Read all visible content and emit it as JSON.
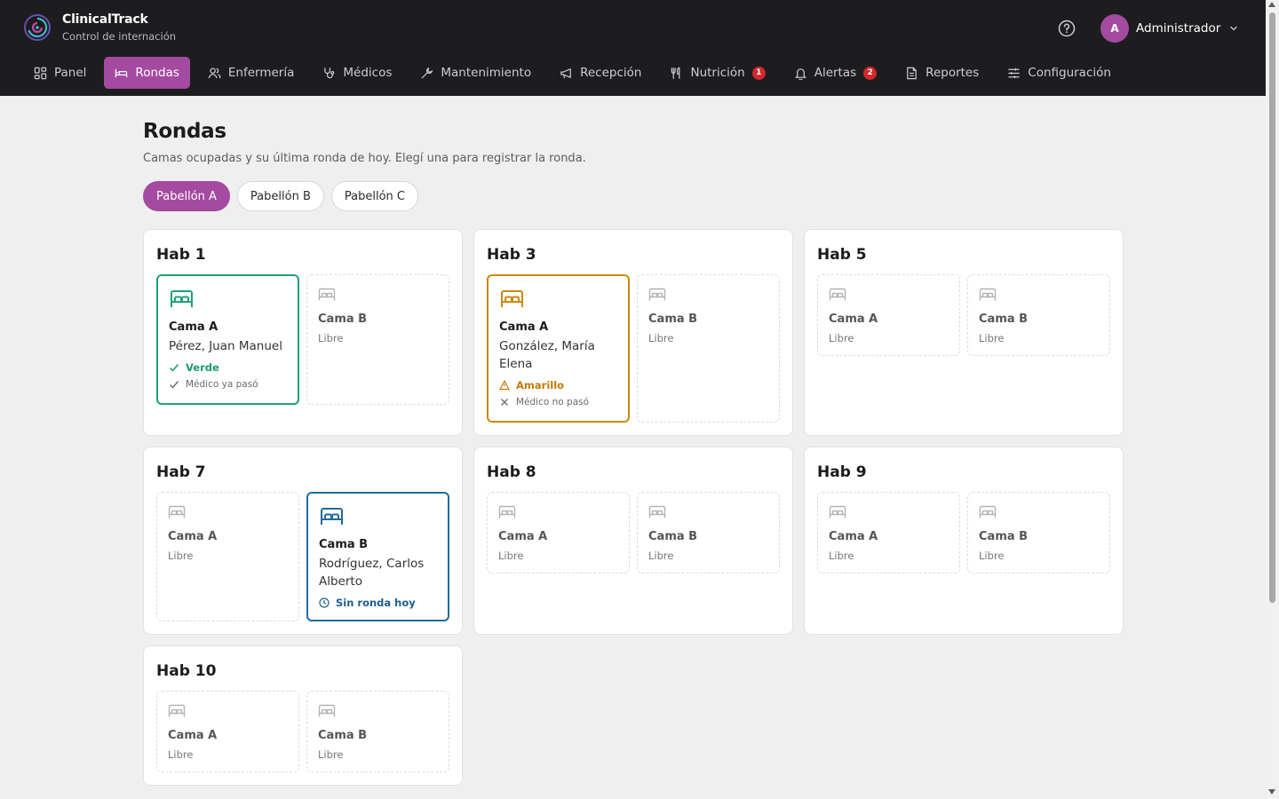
{
  "app": {
    "name": "ClinicalTrack",
    "subtitle": "Control de internación"
  },
  "user": {
    "initial": "A",
    "name": "Administrador"
  },
  "nav": [
    {
      "label": "Panel",
      "icon": "grid-icon"
    },
    {
      "label": "Rondas",
      "icon": "bed-icon",
      "active": true
    },
    {
      "label": "Enfermería",
      "icon": "users-icon"
    },
    {
      "label": "Médicos",
      "icon": "stethoscope-icon"
    },
    {
      "label": "Mantenimiento",
      "icon": "wrench-icon"
    },
    {
      "label": "Recepción",
      "icon": "megaphone-icon"
    },
    {
      "label": "Nutrición",
      "icon": "utensils-icon",
      "badge": "1"
    },
    {
      "label": "Alertas",
      "icon": "bell-icon",
      "badge": "2"
    },
    {
      "label": "Reportes",
      "icon": "file-icon"
    },
    {
      "label": "Configuración",
      "icon": "sliders-icon"
    }
  ],
  "page": {
    "title": "Rondas",
    "subtitle": "Camas ocupadas y su última ronda de hoy. Elegí una para registrar la ronda."
  },
  "pavilions": [
    "Pabellón A",
    "Pabellón B",
    "Pabellón C"
  ],
  "rooms": [
    {
      "title": "Hab 1",
      "beds": [
        {
          "name": "Cama A",
          "patient": "Pérez, Juan Manuel",
          "status": "Verde",
          "doctor": "Médico ya pasó"
        },
        {
          "name": "Cama B",
          "status": "Libre"
        }
      ]
    },
    {
      "title": "Hab 3",
      "beds": [
        {
          "name": "Cama A",
          "patient": "González, María Elena",
          "status": "Amarillo",
          "doctor": "Médico no pasó"
        },
        {
          "name": "Cama B",
          "status": "Libre"
        }
      ]
    },
    {
      "title": "Hab 5",
      "beds": [
        {
          "name": "Cama A",
          "status": "Libre"
        },
        {
          "name": "Cama B",
          "status": "Libre"
        }
      ]
    },
    {
      "title": "Hab 7",
      "beds": [
        {
          "name": "Cama A",
          "status": "Libre"
        },
        {
          "name": "Cama B",
          "patient": "Rodríguez, Carlos Alberto",
          "status": "Sin ronda hoy"
        }
      ]
    },
    {
      "title": "Hab 8",
      "beds": [
        {
          "name": "Cama A",
          "status": "Libre"
        },
        {
          "name": "Cama B",
          "status": "Libre"
        }
      ]
    },
    {
      "title": "Hab 9",
      "beds": [
        {
          "name": "Cama A",
          "status": "Libre"
        },
        {
          "name": "Cama B",
          "status": "Libre"
        }
      ]
    },
    {
      "title": "Hab 10",
      "beds": [
        {
          "name": "Cama A",
          "status": "Libre"
        },
        {
          "name": "Cama B",
          "status": "Libre"
        }
      ]
    }
  ],
  "colors": {
    "accent": "#a44aa0",
    "green": "#21a076",
    "amber": "#c98a0c",
    "blue": "#216b9c",
    "badge": "#d3282c"
  }
}
